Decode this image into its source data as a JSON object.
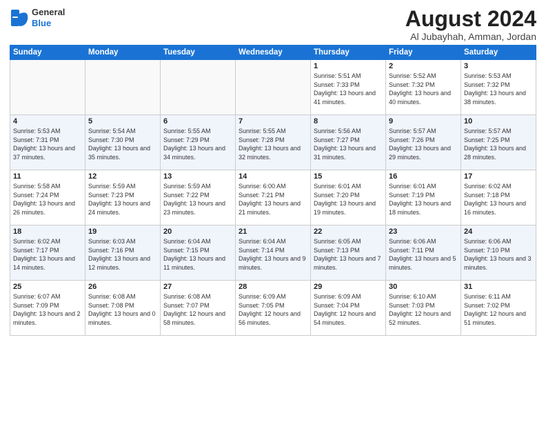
{
  "logo": {
    "general": "General",
    "blue": "Blue"
  },
  "title": {
    "month_year": "August 2024",
    "location": "Al Jubayhah, Amman, Jordan"
  },
  "weekdays": [
    "Sunday",
    "Monday",
    "Tuesday",
    "Wednesday",
    "Thursday",
    "Friday",
    "Saturday"
  ],
  "weeks": [
    [
      {
        "day": "",
        "info": ""
      },
      {
        "day": "",
        "info": ""
      },
      {
        "day": "",
        "info": ""
      },
      {
        "day": "",
        "info": ""
      },
      {
        "day": "1",
        "info": "Sunrise: 5:51 AM\nSunset: 7:33 PM\nDaylight: 13 hours\nand 41 minutes."
      },
      {
        "day": "2",
        "info": "Sunrise: 5:52 AM\nSunset: 7:32 PM\nDaylight: 13 hours\nand 40 minutes."
      },
      {
        "day": "3",
        "info": "Sunrise: 5:53 AM\nSunset: 7:32 PM\nDaylight: 13 hours\nand 38 minutes."
      }
    ],
    [
      {
        "day": "4",
        "info": "Sunrise: 5:53 AM\nSunset: 7:31 PM\nDaylight: 13 hours\nand 37 minutes."
      },
      {
        "day": "5",
        "info": "Sunrise: 5:54 AM\nSunset: 7:30 PM\nDaylight: 13 hours\nand 35 minutes."
      },
      {
        "day": "6",
        "info": "Sunrise: 5:55 AM\nSunset: 7:29 PM\nDaylight: 13 hours\nand 34 minutes."
      },
      {
        "day": "7",
        "info": "Sunrise: 5:55 AM\nSunset: 7:28 PM\nDaylight: 13 hours\nand 32 minutes."
      },
      {
        "day": "8",
        "info": "Sunrise: 5:56 AM\nSunset: 7:27 PM\nDaylight: 13 hours\nand 31 minutes."
      },
      {
        "day": "9",
        "info": "Sunrise: 5:57 AM\nSunset: 7:26 PM\nDaylight: 13 hours\nand 29 minutes."
      },
      {
        "day": "10",
        "info": "Sunrise: 5:57 AM\nSunset: 7:25 PM\nDaylight: 13 hours\nand 28 minutes."
      }
    ],
    [
      {
        "day": "11",
        "info": "Sunrise: 5:58 AM\nSunset: 7:24 PM\nDaylight: 13 hours\nand 26 minutes."
      },
      {
        "day": "12",
        "info": "Sunrise: 5:59 AM\nSunset: 7:23 PM\nDaylight: 13 hours\nand 24 minutes."
      },
      {
        "day": "13",
        "info": "Sunrise: 5:59 AM\nSunset: 7:22 PM\nDaylight: 13 hours\nand 23 minutes."
      },
      {
        "day": "14",
        "info": "Sunrise: 6:00 AM\nSunset: 7:21 PM\nDaylight: 13 hours\nand 21 minutes."
      },
      {
        "day": "15",
        "info": "Sunrise: 6:01 AM\nSunset: 7:20 PM\nDaylight: 13 hours\nand 19 minutes."
      },
      {
        "day": "16",
        "info": "Sunrise: 6:01 AM\nSunset: 7:19 PM\nDaylight: 13 hours\nand 18 minutes."
      },
      {
        "day": "17",
        "info": "Sunrise: 6:02 AM\nSunset: 7:18 PM\nDaylight: 13 hours\nand 16 minutes."
      }
    ],
    [
      {
        "day": "18",
        "info": "Sunrise: 6:02 AM\nSunset: 7:17 PM\nDaylight: 13 hours\nand 14 minutes."
      },
      {
        "day": "19",
        "info": "Sunrise: 6:03 AM\nSunset: 7:16 PM\nDaylight: 13 hours\nand 12 minutes."
      },
      {
        "day": "20",
        "info": "Sunrise: 6:04 AM\nSunset: 7:15 PM\nDaylight: 13 hours\nand 11 minutes."
      },
      {
        "day": "21",
        "info": "Sunrise: 6:04 AM\nSunset: 7:14 PM\nDaylight: 13 hours\nand 9 minutes."
      },
      {
        "day": "22",
        "info": "Sunrise: 6:05 AM\nSunset: 7:13 PM\nDaylight: 13 hours\nand 7 minutes."
      },
      {
        "day": "23",
        "info": "Sunrise: 6:06 AM\nSunset: 7:11 PM\nDaylight: 13 hours\nand 5 minutes."
      },
      {
        "day": "24",
        "info": "Sunrise: 6:06 AM\nSunset: 7:10 PM\nDaylight: 13 hours\nand 3 minutes."
      }
    ],
    [
      {
        "day": "25",
        "info": "Sunrise: 6:07 AM\nSunset: 7:09 PM\nDaylight: 13 hours\nand 2 minutes."
      },
      {
        "day": "26",
        "info": "Sunrise: 6:08 AM\nSunset: 7:08 PM\nDaylight: 13 hours\nand 0 minutes."
      },
      {
        "day": "27",
        "info": "Sunrise: 6:08 AM\nSunset: 7:07 PM\nDaylight: 12 hours\nand 58 minutes."
      },
      {
        "day": "28",
        "info": "Sunrise: 6:09 AM\nSunset: 7:05 PM\nDaylight: 12 hours\nand 56 minutes."
      },
      {
        "day": "29",
        "info": "Sunrise: 6:09 AM\nSunset: 7:04 PM\nDaylight: 12 hours\nand 54 minutes."
      },
      {
        "day": "30",
        "info": "Sunrise: 6:10 AM\nSunset: 7:03 PM\nDaylight: 12 hours\nand 52 minutes."
      },
      {
        "day": "31",
        "info": "Sunrise: 6:11 AM\nSunset: 7:02 PM\nDaylight: 12 hours\nand 51 minutes."
      }
    ]
  ]
}
